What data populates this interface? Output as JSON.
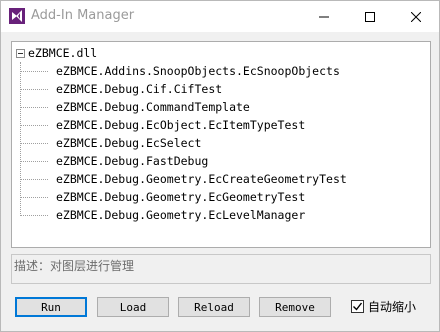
{
  "window": {
    "title": "Add-In Manager",
    "app_icon": "visual-studio-icon"
  },
  "tree": {
    "root": {
      "label": "eZBMCE.dll",
      "expanded": true
    },
    "items": [
      {
        "label": "eZBMCE.Addins.SnoopObjects.EcSnoopObjects"
      },
      {
        "label": "eZBMCE.Debug.Cif.CifTest"
      },
      {
        "label": "eZBMCE.Debug.CommandTemplate"
      },
      {
        "label": "eZBMCE.Debug.EcObject.EcItemTypeTest"
      },
      {
        "label": "eZBMCE.Debug.EcSelect"
      },
      {
        "label": "eZBMCE.Debug.FastDebug"
      },
      {
        "label": "eZBMCE.Debug.Geometry.EcCreateGeometryTest"
      },
      {
        "label": "eZBMCE.Debug.Geometry.EcGeometryTest"
      },
      {
        "label": "eZBMCE.Debug.Geometry.EcLevelManager"
      }
    ]
  },
  "description": {
    "text": "描述：对图层进行管理"
  },
  "buttons": {
    "run": "Run",
    "load": "Load",
    "reload": "Reload",
    "remove": "Remove"
  },
  "auto_minimize": {
    "label": "自动缩小",
    "checked": true
  },
  "colors": {
    "accent": "#0078d7",
    "icon_purple": "#68217a"
  }
}
